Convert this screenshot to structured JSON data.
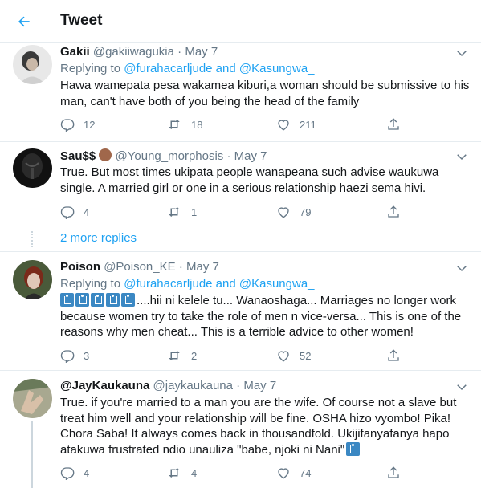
{
  "header": {
    "title": "Tweet"
  },
  "tweets": [
    {
      "name": "Gakii",
      "handle": "@gakiiwagukia",
      "dot": "·",
      "date": "May 7",
      "replying_prefix": "Replying to ",
      "replying_user1": "@furahacarljude",
      "replying_and": " and ",
      "replying_user2": "@Kasungwa_",
      "text": "Hawa wamepata pesa wakamea kiburi,a woman should be submissive to his man, can't have both of you being the head of the family",
      "replies": "12",
      "retweets": "18",
      "likes": "211"
    },
    {
      "name": "Sau$$",
      "handle": "@Young_morphosis",
      "dot": "·",
      "date": "May 7",
      "text": "True.  But most times ukipata people wanapeana such advise waukuwa single. A married girl or one in a serious relationship haezi sema hivi.",
      "replies": "4",
      "retweets": "1",
      "likes": "79"
    },
    {
      "name": "Poison",
      "handle": "@Poison_KE",
      "dot": "·",
      "date": "May 7",
      "replying_prefix": "Replying to ",
      "replying_user1": "@furahacarljude",
      "replying_and": " and ",
      "replying_user2": "@Kasungwa_",
      "text_after_emoji": "....hii ni kelele tu... Wanaoshaga... Marriages no longer work because women try to take the role of men n vice-versa... This is one of the reasons why men cheat... This is a terrible advice to other women!",
      "replies": "3",
      "retweets": "2",
      "likes": "52"
    },
    {
      "name": "@JayKaukauna",
      "handle": "@jaykaukauna",
      "dot": "·",
      "date": "May 7",
      "text": "True. if you're married to a man you are the wife. Of course not a slave but treat him well and your relationship will be fine. OSHA hizo vyombo! Pika! Chora Saba! It always comes back in thousandfold. Ukijifanyafanya hapo atakuwa frustrated ndio unauliza \"babe, njoki ni Nani\"",
      "replies": "4",
      "retweets": "4",
      "likes": "74"
    }
  ],
  "more_replies": "2 more replies",
  "colors": {
    "accent": "#1da1f2",
    "muted": "#657786",
    "border": "#e6ecf0",
    "text": "#14171a"
  },
  "icons": [
    "back-arrow-icon",
    "chevron-down-icon",
    "reply-icon",
    "retweet-icon",
    "like-icon",
    "share-icon",
    "emoji-icon"
  ]
}
